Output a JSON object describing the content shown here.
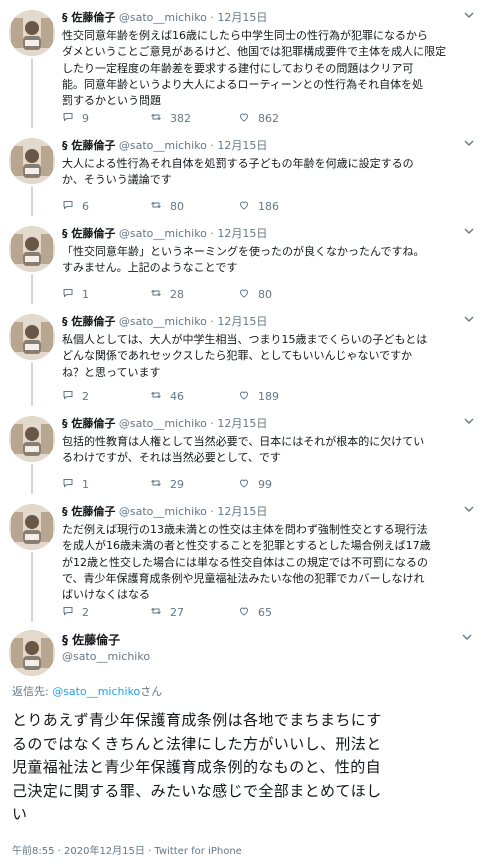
{
  "thread": [
    {
      "name": "§ 佐藤倫子",
      "handle": "@sato__michiko",
      "time": "12月15日",
      "text": "性交同意年齢を例えば16歳にしたら中学生同士の性行為が犯罪になるから\nダメということご意見があるけど、他国では犯罪構成要件で主体を成人に限定\nしたり一定程度の年齢差を要求する建付にしておりその問題はクリア可\n能。同意年齢というより大人によるローティーンとの性行為それ自体を処\n罰するかという問題",
      "replies": "9",
      "retweets": "382",
      "likes": "862"
    },
    {
      "name": "§ 佐藤倫子",
      "handle": "@sato__michiko",
      "time": "12月15日",
      "text": "大人による性行為それ自体を処罰する子どもの年齢を何歳に設定するの\nか、そういう議論です",
      "replies": "6",
      "retweets": "80",
      "likes": "186"
    },
    {
      "name": "§ 佐藤倫子",
      "handle": "@sato__michiko",
      "time": "12月15日",
      "text": "「性交同意年齢」というネーミングを使ったのが良くなかったんですね。\nすみません。上記のようなことです",
      "replies": "1",
      "retweets": "28",
      "likes": "80"
    },
    {
      "name": "§ 佐藤倫子",
      "handle": "@sato__michiko",
      "time": "12月15日",
      "text": "私個人としては、大人が中学生相当、つまり15歳までくらいの子どもとは\nどんな関係であれセックスしたら犯罪、としてもいいんじゃないですか\nね？と思っています",
      "replies": "2",
      "retweets": "46",
      "likes": "189"
    },
    {
      "name": "§ 佐藤倫子",
      "handle": "@sato__michiko",
      "time": "12月15日",
      "text": "包括的性教育は人権として当然必要で、日本にはそれが根本的に欠けてい\nるわけですが、それは当然必要として、です",
      "replies": "1",
      "retweets": "29",
      "likes": "99"
    },
    {
      "name": "§ 佐藤倫子",
      "handle": "@sato__michiko",
      "time": "12月15日",
      "text": "ただ例えば現行の13歳未満との性交は主体を問わず強制性交とする現行法\nを成人が16歳未満の者と性交することを犯罪とするとした場合例えば17歳\nが12歳と性交した場合には単なる性交自体はこの規定では不可罰になるの\nで、青少年保護育成条例や児童福祉法みたいな他の犯罪でカバーしなけれ\nばいけなくはなる",
      "replies": "2",
      "retweets": "27",
      "likes": "65"
    }
  ],
  "main": {
    "name": "§ 佐藤倫子",
    "handle": "@sato__michiko",
    "replying_prefix": "返信先: ",
    "replying_mention": "@sato__michiko",
    "replying_suffix": "さん",
    "text": "とりあえず青少年保護育成条例は各地でまちまちにす\nるのではなくきちんと法律にした方がいいし、刑法と\n児童福祉法と青少年保護育成条例的なものと、性的自\n己決定に関する罪、みたいな感じで全部まとめてほし\nい",
    "meta": "午前8:55 · 2020年12月15日 · Twitter for iPhone"
  },
  "icons": {
    "reply": "reply-icon",
    "retweet": "retweet-icon",
    "like": "heart-icon",
    "caret": "chevron-down-icon"
  }
}
